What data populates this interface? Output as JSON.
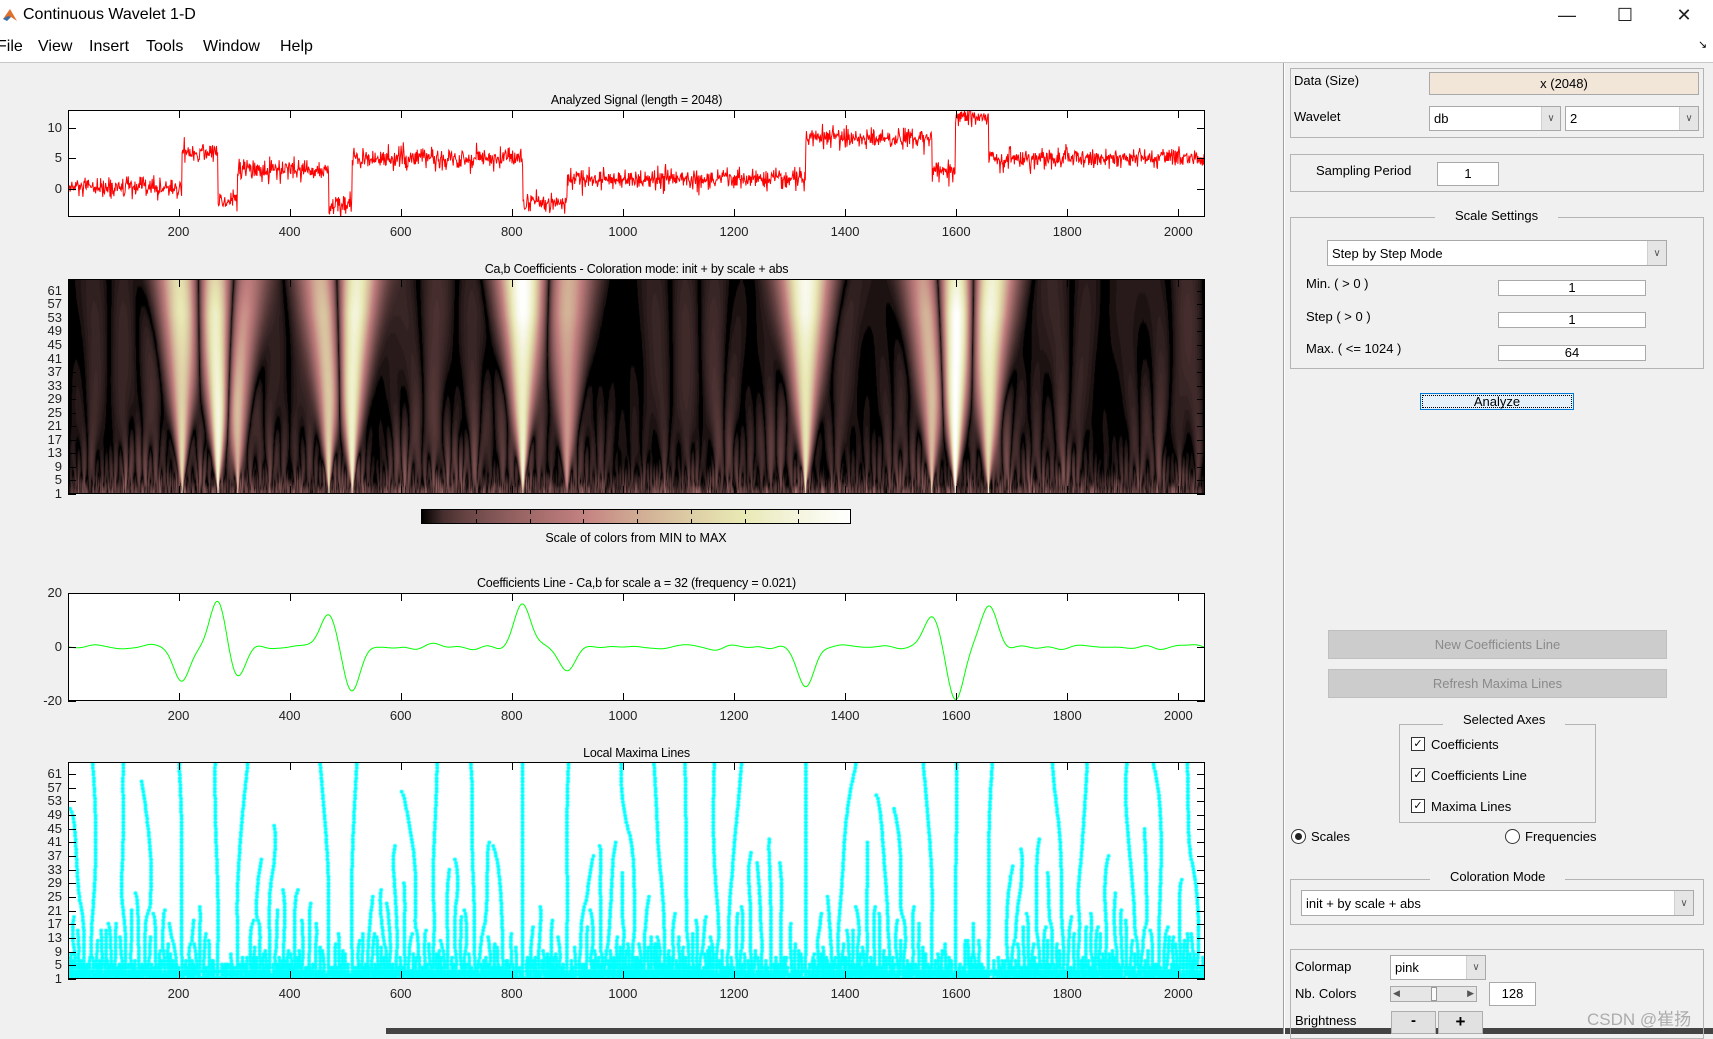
{
  "window": {
    "title": "Continuous Wavelet 1-D",
    "minimize": "—",
    "maximize": "☐",
    "close": "✕"
  },
  "menu": [
    "File",
    "View",
    "Insert",
    "Tools",
    "Window",
    "Help"
  ],
  "chart_data": [
    {
      "type": "line",
      "title": "Analyzed Signal (length = 2048)",
      "length": 2048,
      "xlim": [
        1,
        2048
      ],
      "ylim": [
        -4.7,
        13
      ],
      "xticks": [
        200,
        400,
        600,
        800,
        1000,
        1200,
        1400,
        1600,
        1800,
        2000
      ],
      "yticks": [
        0,
        5,
        10
      ],
      "color": "#ff0000",
      "piecewise_levels": [
        {
          "from": 1,
          "to": 205,
          "level": 0
        },
        {
          "from": 205,
          "to": 270,
          "level": 6
        },
        {
          "from": 270,
          "to": 305,
          "level": -2
        },
        {
          "from": 305,
          "to": 470,
          "level": 3
        },
        {
          "from": 470,
          "to": 512,
          "level": -3
        },
        {
          "from": 512,
          "to": 820,
          "level": 5
        },
        {
          "from": 820,
          "to": 900,
          "level": -2.5
        },
        {
          "from": 900,
          "to": 1330,
          "level": 1.5
        },
        {
          "from": 1330,
          "to": 1558,
          "level": 8.5
        },
        {
          "from": 1558,
          "to": 1600,
          "level": 3
        },
        {
          "from": 1600,
          "to": 1660,
          "level": 12
        },
        {
          "from": 1660,
          "to": 2048,
          "level": 5
        }
      ],
      "noise_std": 0.9
    },
    {
      "type": "heatmap",
      "title": "Ca,b Coefficients - Coloration mode: init + by scale + abs",
      "xlim": [
        1,
        2048
      ],
      "scales": [
        1,
        64
      ],
      "yticks": [
        1,
        5,
        9,
        13,
        17,
        21,
        25,
        29,
        33,
        37,
        41,
        45,
        49,
        53,
        57,
        61
      ],
      "colormap": "pink",
      "colorbar_label": "Scale of colors from MIN to MAX"
    },
    {
      "type": "line",
      "title": "Coefficients Line - Ca,b for scale a = 32  (frequency =   0.021)",
      "scale": 32,
      "xlim": [
        1,
        2048
      ],
      "ylim": [
        -20,
        20
      ],
      "xticks": [
        200,
        400,
        600,
        800,
        1000,
        1200,
        1400,
        1600,
        1800,
        2000
      ],
      "yticks": [
        -20,
        0,
        20
      ],
      "color": "#00ff00"
    },
    {
      "type": "scatter",
      "title": "Local Maxima Lines",
      "xlim": [
        1,
        2048
      ],
      "scales": [
        1,
        64
      ],
      "xticks": [
        200,
        400,
        600,
        800,
        1000,
        1200,
        1400,
        1600,
        1800,
        2000
      ],
      "yticks": [
        1,
        5,
        9,
        13,
        17,
        21,
        25,
        29,
        33,
        37,
        41,
        45,
        49,
        53,
        57,
        61
      ],
      "color": "#00ffff"
    }
  ],
  "panel": {
    "data_label": "Data  (Size)",
    "data_value": "x  (2048)",
    "wavelet_label": "Wavelet",
    "wavelet_family": "db",
    "wavelet_order": "2",
    "sampling_label": "Sampling Period",
    "sampling_value": "1",
    "scale_settings_title": "Scale Settings",
    "scale_mode": "Step by Step Mode",
    "min_label": "Min.  ( > 0 )",
    "min_value": "1",
    "step_label": "Step  ( > 0 )",
    "step_value": "1",
    "max_label": "Max.  ( <= 1024 )",
    "max_value": "64",
    "analyze": "Analyze",
    "new_coef_line": "New Coefficients Line",
    "refresh_maxima": "Refresh Maxima Lines",
    "selected_axes_title": "Selected Axes",
    "axes_checks": [
      {
        "label": "Coefficients",
        "checked": true
      },
      {
        "label": "Coefficients Line",
        "checked": true
      },
      {
        "label": "Maxima Lines",
        "checked": true
      }
    ],
    "radio_scales": "Scales",
    "radio_frequencies": "Frequencies",
    "selected_radio": "Scales",
    "coloration_title": "Coloration Mode",
    "coloration_value": "init + by scale + abs",
    "colormap_label": "Colormap",
    "colormap_value": "pink",
    "nb_colors_label": "Nb. Colors",
    "nb_colors_value": "128",
    "brightness_label": "Brightness",
    "brightness_minus": "-",
    "brightness_plus": "+"
  },
  "watermark": "CSDN @崔扬"
}
